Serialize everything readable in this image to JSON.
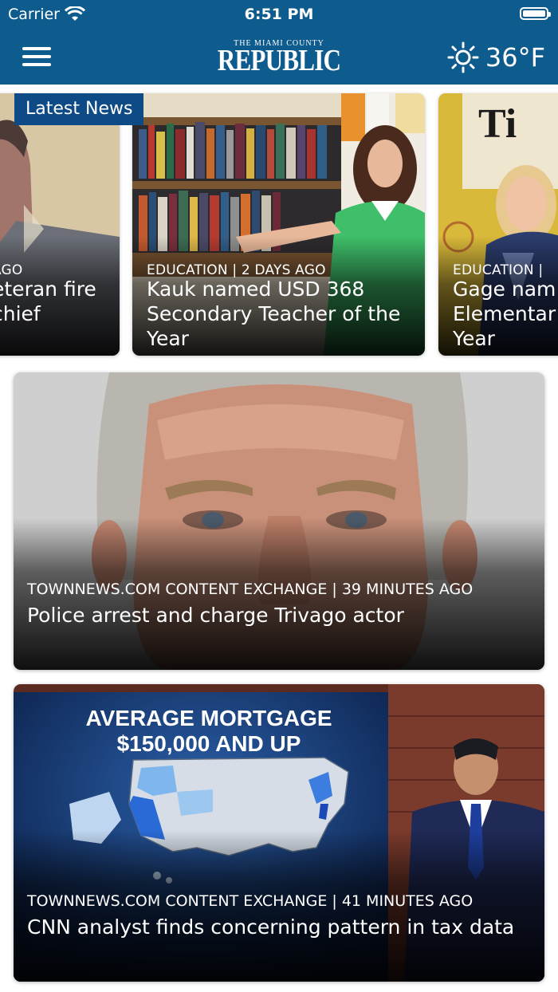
{
  "status_bar": {
    "carrier": "Carrier",
    "time": "6:51 PM"
  },
  "header": {
    "logo_small": "THE MIAMI COUNTY",
    "logo_big": "REPUBLIC",
    "temperature": "36°F",
    "weather_icon": "sun-icon",
    "menu_icon": "hamburger-menu-icon",
    "bar_color": "#0e5c8e"
  },
  "carousel": {
    "badge": "Latest News",
    "badge_color": "#0e4a86",
    "cards": [
      {
        "meta": "AGO",
        "headline": "eteran fire chief"
      },
      {
        "meta": "EDUCATION | 2 DAYS AGO",
        "headline": "Kauk named USD 368 Secondary Teacher of the Year"
      },
      {
        "meta": "EDUCATION |",
        "headline": "Gage nam Elementar Year"
      }
    ]
  },
  "feed": [
    {
      "meta": "TOWNNEWS.COM CONTENT EXCHANGE | 39 MINUTES AGO",
      "headline": "Police arrest and charge Trivago actor"
    },
    {
      "meta": "TOWNNEWS.COM CONTENT EXCHANGE | 41 MINUTES AGO",
      "headline": "CNN analyst finds concerning pattern in tax data",
      "screen_line1": "AVERAGE MORTGAGE",
      "screen_line2": "$150,000 AND UP"
    }
  ]
}
